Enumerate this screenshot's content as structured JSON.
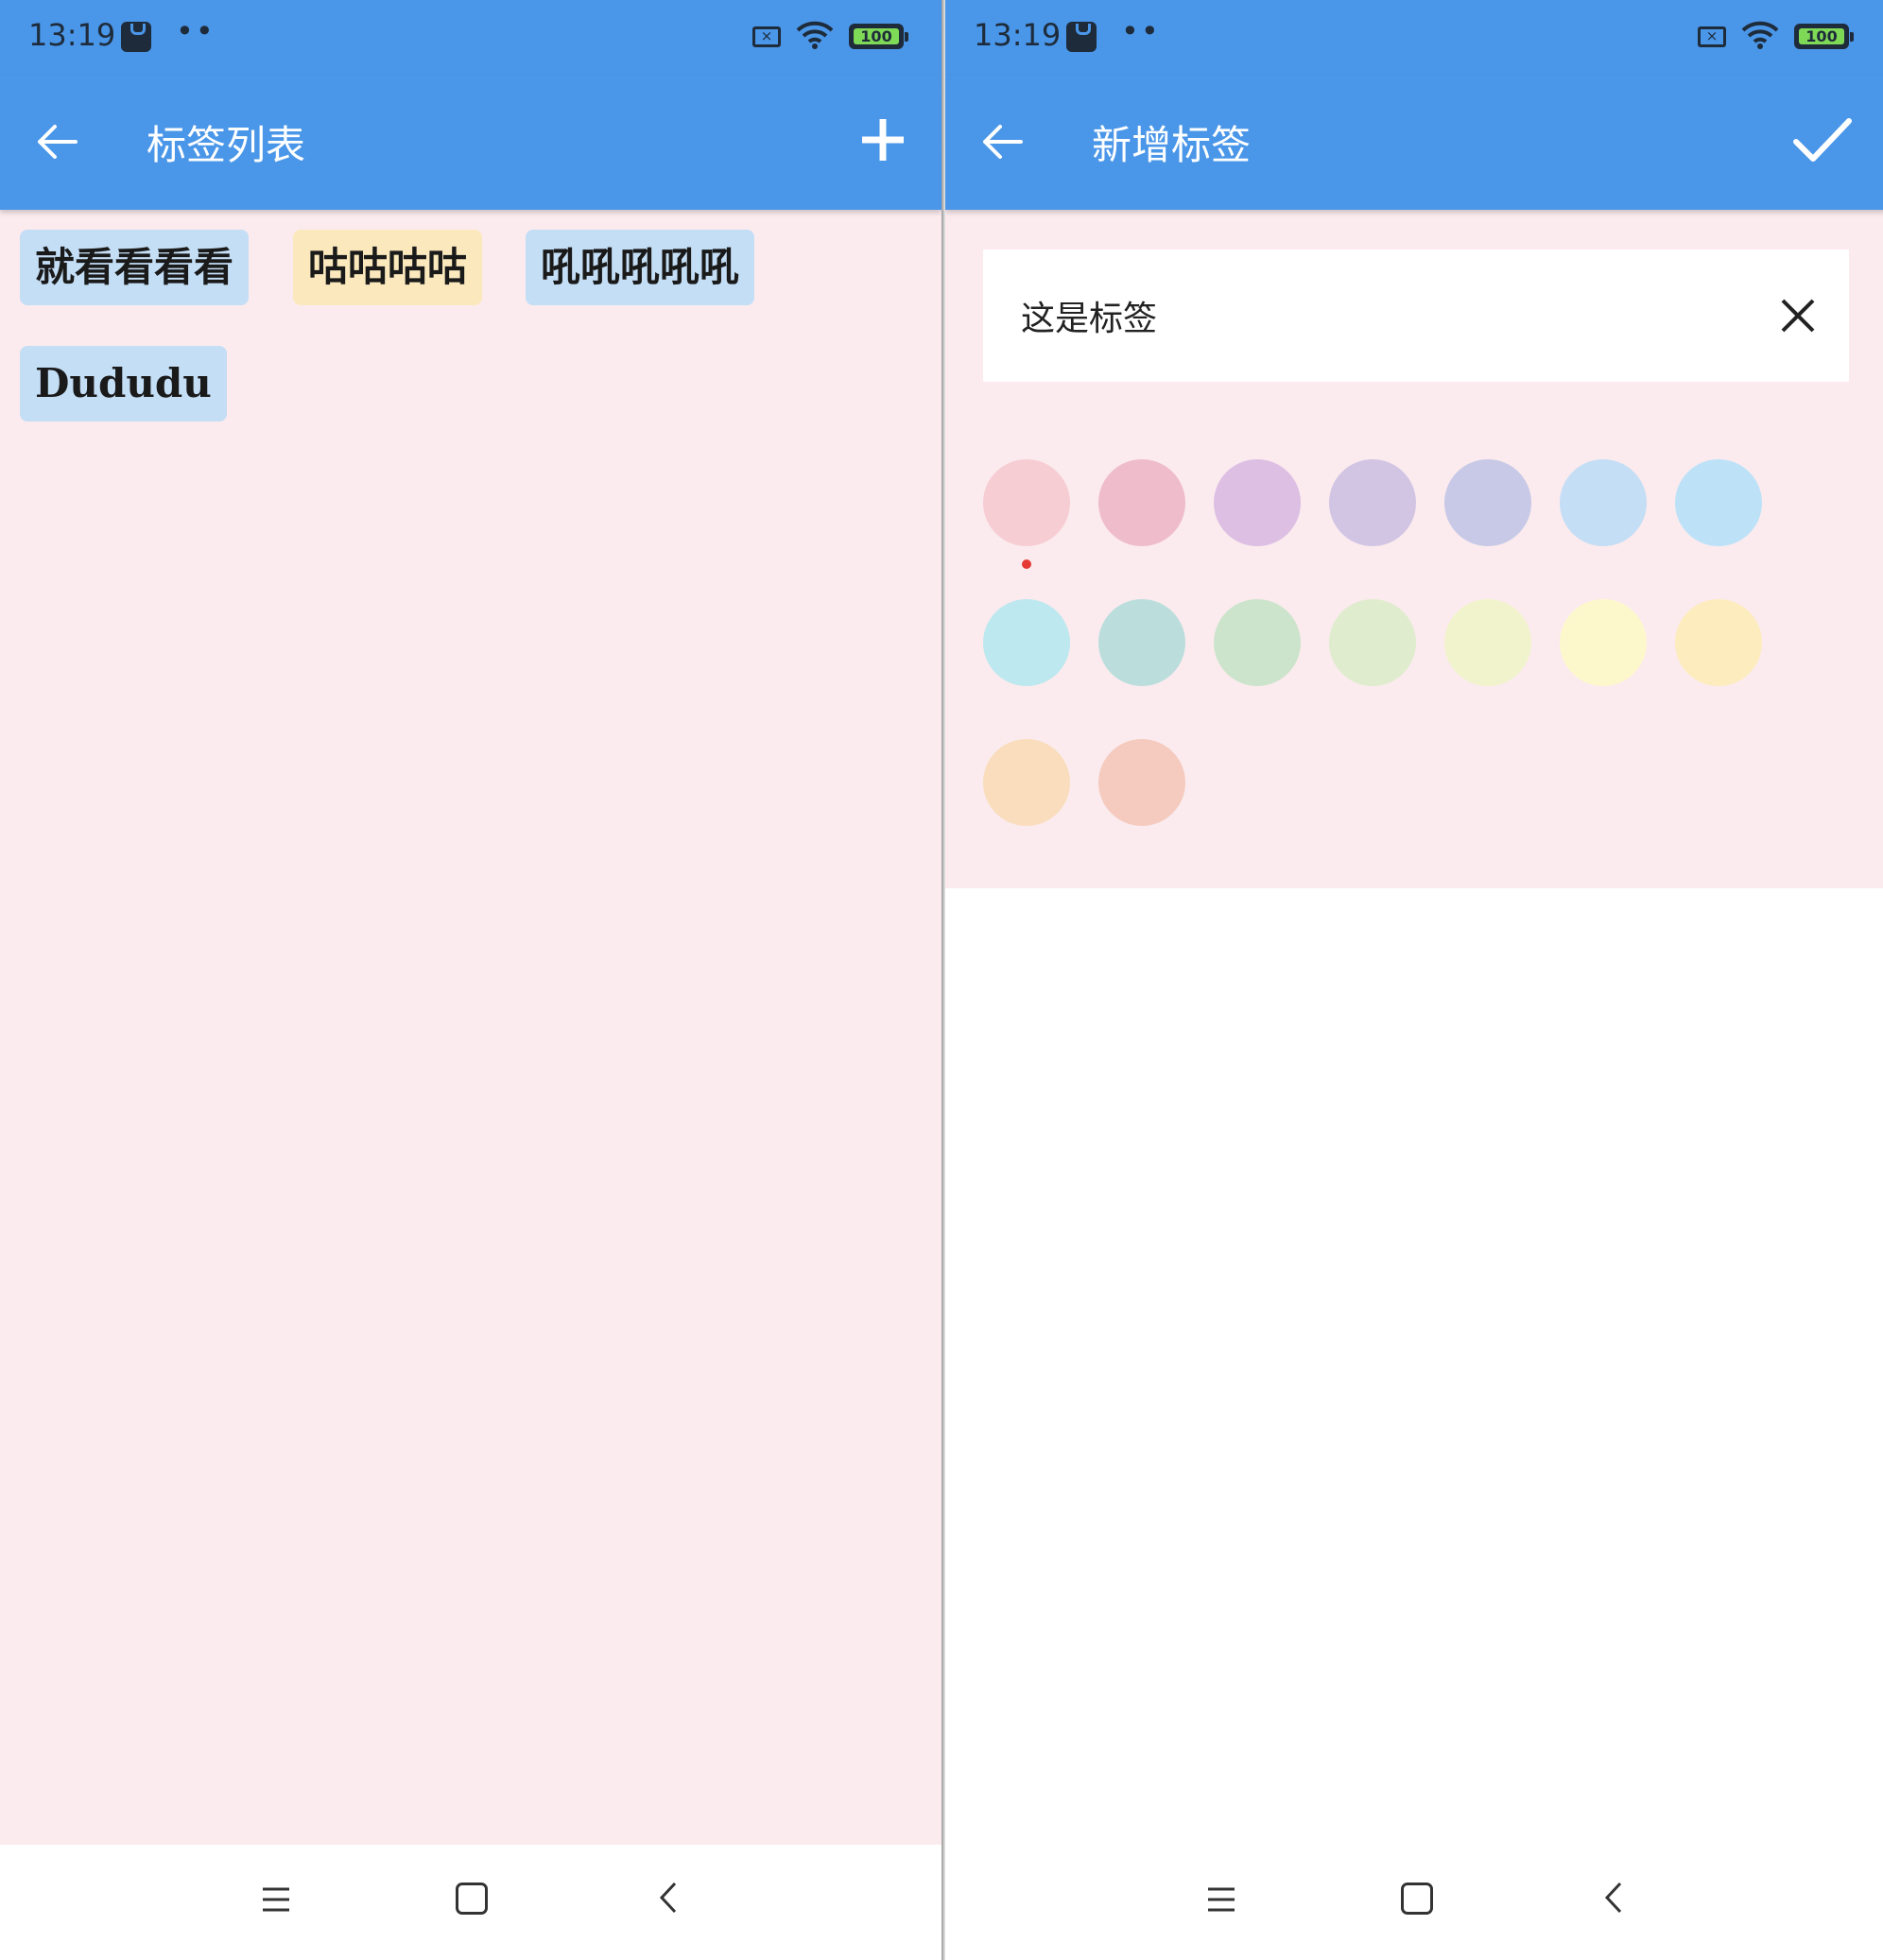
{
  "left_screen": {
    "status": {
      "time": "13:19",
      "dots": "••",
      "battery": "100"
    },
    "appbar": {
      "title": "标签列表",
      "back_icon": "arrow-left-icon",
      "action_icon": "plus-icon"
    },
    "tags": [
      {
        "label": "就看看看看",
        "color": "#c4def5"
      },
      {
        "label": "咕咕咕咕",
        "color": "#fbe9bd"
      },
      {
        "label": "吼吼吼吼吼",
        "color": "#c4def5"
      },
      {
        "label": "Dududu",
        "color": "#c4def5"
      }
    ]
  },
  "right_screen": {
    "status": {
      "time": "13:19",
      "dots": "••",
      "battery": "100"
    },
    "appbar": {
      "title": "新增标签",
      "back_icon": "arrow-left-icon",
      "action_icon": "check-icon"
    },
    "input": {
      "value": "这是标签",
      "clear_icon": "close-icon"
    },
    "palette": {
      "selected_index": 0,
      "colors": [
        "#f7cdd4",
        "#efbccb",
        "#dcbfe3",
        "#d2c5e4",
        "#c8c9e7",
        "#c4def5",
        "#bde2f8",
        "#bde8ef",
        "#bbdedd",
        "#cde4cc",
        "#e0ecce",
        "#f1f3cc",
        "#fdf8cc",
        "#fdecbd",
        "#f9ddbc",
        "#f5cbbf"
      ]
    }
  },
  "navbar": {
    "menu_icon": "menu-icon",
    "home_icon": "home-icon",
    "back_icon": "chevron-left-icon"
  }
}
